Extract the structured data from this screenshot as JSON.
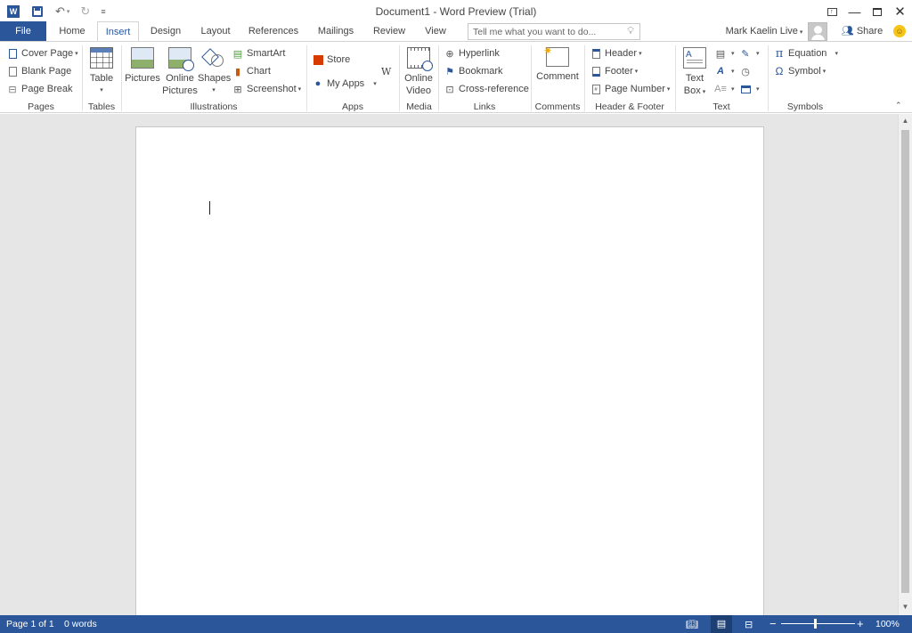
{
  "window": {
    "title": "Document1 - Word Preview (Trial)",
    "user": "Mark Kaelin Live",
    "share": "Share"
  },
  "tabs": [
    "File",
    "Home",
    "Insert",
    "Design",
    "Layout",
    "References",
    "Mailings",
    "Review",
    "View"
  ],
  "active_tab": "Insert",
  "tellme_placeholder": "Tell me what you want to do...",
  "ribbon": {
    "pages": {
      "label": "Pages",
      "cover_page": "Cover Page",
      "blank_page": "Blank Page",
      "page_break": "Page Break"
    },
    "tables": {
      "label": "Tables",
      "table": "Table"
    },
    "illustrations": {
      "label": "Illustrations",
      "pictures": "Pictures",
      "online_pictures_1": "Online",
      "online_pictures_2": "Pictures",
      "shapes": "Shapes",
      "smartart": "SmartArt",
      "chart": "Chart",
      "screenshot": "Screenshot"
    },
    "apps": {
      "label": "Apps",
      "store": "Store",
      "my_apps": "My Apps",
      "wiki": "W"
    },
    "media": {
      "label": "Media",
      "online_video_1": "Online",
      "online_video_2": "Video"
    },
    "links": {
      "label": "Links",
      "hyperlink": "Hyperlink",
      "bookmark": "Bookmark",
      "cross_reference": "Cross-reference"
    },
    "comments": {
      "label": "Comments",
      "comment": "Comment"
    },
    "header_footer": {
      "label": "Header & Footer",
      "header": "Header",
      "footer": "Footer",
      "page_number": "Page Number"
    },
    "text": {
      "label": "Text",
      "text_box_1": "Text",
      "text_box_2": "Box"
    },
    "symbols": {
      "label": "Symbols",
      "equation": "Equation",
      "symbol": "Symbol",
      "pi": "π",
      "omega": "Ω"
    }
  },
  "status": {
    "page": "Page 1 of 1",
    "words": "0 words",
    "zoom": "100%"
  },
  "colors": {
    "accent": "#2b579a"
  }
}
